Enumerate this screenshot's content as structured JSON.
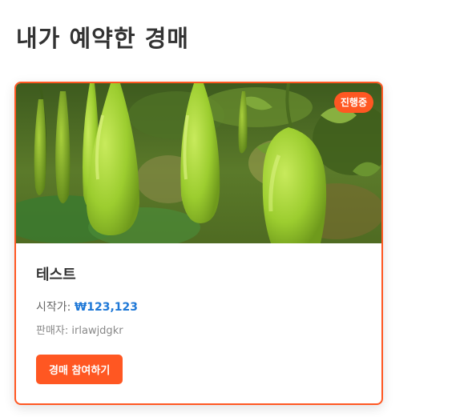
{
  "page": {
    "title": "내가 예약한 경매"
  },
  "auction_card": {
    "status_badge": "진행중",
    "item_title": "테스트",
    "start_price_label": "시작가: ",
    "start_price_value": "₩123,123",
    "seller_label": "판매자: ",
    "seller_name": "irlawjdgkr",
    "join_button_label": "경매 참여하기",
    "image_subject": "bottle-gourds-hanging-on-vine"
  },
  "colors": {
    "accent": "#ff5722",
    "price": "#1e78d7",
    "title_text": "#333333"
  }
}
